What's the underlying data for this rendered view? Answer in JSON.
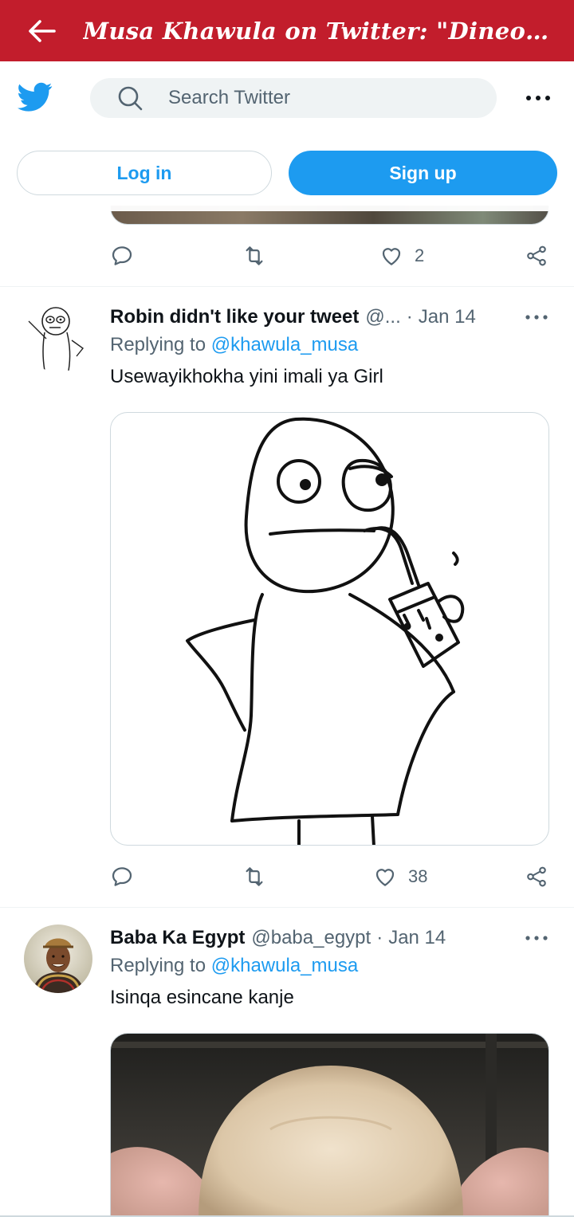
{
  "appbar": {
    "title": "Musa Khawula on Twitter: \"Dineo Ran...",
    "back_icon": "arrow-left-icon"
  },
  "header": {
    "logo_icon": "twitter-bird-icon",
    "search_placeholder": "Search Twitter",
    "more_icon": "more-horizontal-icon",
    "login_label": "Log in",
    "signup_label": "Sign up"
  },
  "colors": {
    "appbar": "#c21d2c",
    "accent": "#1d9bf0",
    "text": "#0f1419",
    "muted": "#536471",
    "search_bg": "#eff3f4"
  },
  "prev_tweet": {
    "retweets": "",
    "likes": "2"
  },
  "tweets": [
    {
      "name": "Robin didn't like your tweet",
      "handle": "@...",
      "sep": "·",
      "date": "Jan 14",
      "replying_prefix": "Replying to ",
      "replying_to": "@khawula_musa",
      "text": "Usewayikhokha yini imali ya Girl",
      "likes": "38"
    },
    {
      "name": "Baba Ka Egypt",
      "handle": "@baba_egypt",
      "sep": "·",
      "date": "Jan 14",
      "replying_prefix": "Replying to ",
      "replying_to": "@khawula_musa",
      "text": "Isinqa esincane kanje",
      "likes": ""
    }
  ]
}
